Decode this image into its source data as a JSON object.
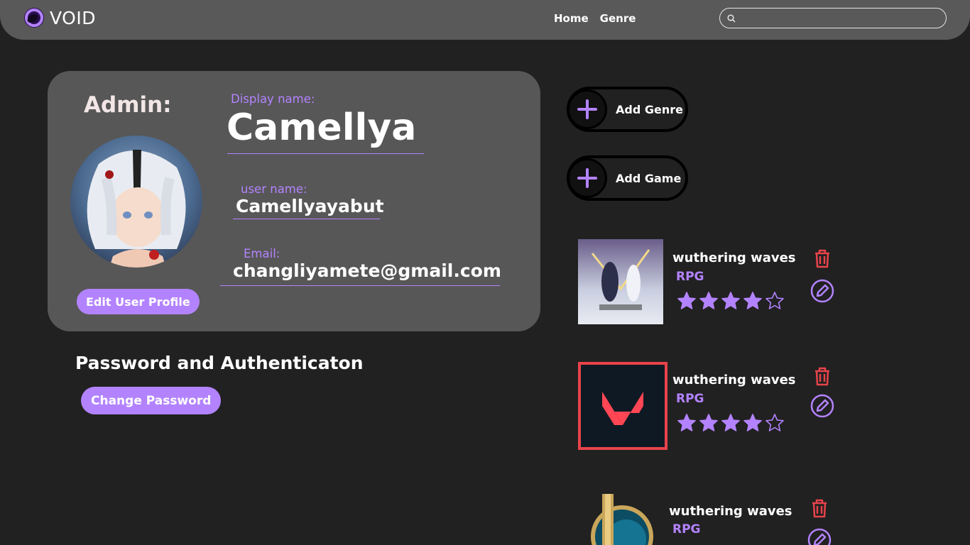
{
  "header": {
    "logo_text": "VOID",
    "nav": {
      "home": "Home",
      "genre": "Genre"
    },
    "search_placeholder": ""
  },
  "profile": {
    "role_label": "Admin:",
    "display_name_label": "Display name:",
    "display_name": "Camellya",
    "username_label": "user name:",
    "username": "Camellyayabut",
    "email_label": "Email:",
    "email": "changliyamete@gmail.com",
    "edit_button": "Edit User Profile"
  },
  "security": {
    "title": "Password and Authenticaton",
    "change_password_button": "Change Password"
  },
  "actions": {
    "add_genre": "Add Genre",
    "add_game": "Add Game"
  },
  "games": [
    {
      "title": "wuthering waves",
      "genre": "RPG",
      "rating": 4,
      "max_rating": 5
    },
    {
      "title": "wuthering waves",
      "genre": "RPG",
      "rating": 4,
      "max_rating": 5
    },
    {
      "title": "wuthering waves",
      "genre": "RPG"
    }
  ],
  "colors": {
    "accent": "#b383ff",
    "background": "#212121",
    "card": "#575757",
    "header": "#595959",
    "delete": "#e8434b"
  }
}
